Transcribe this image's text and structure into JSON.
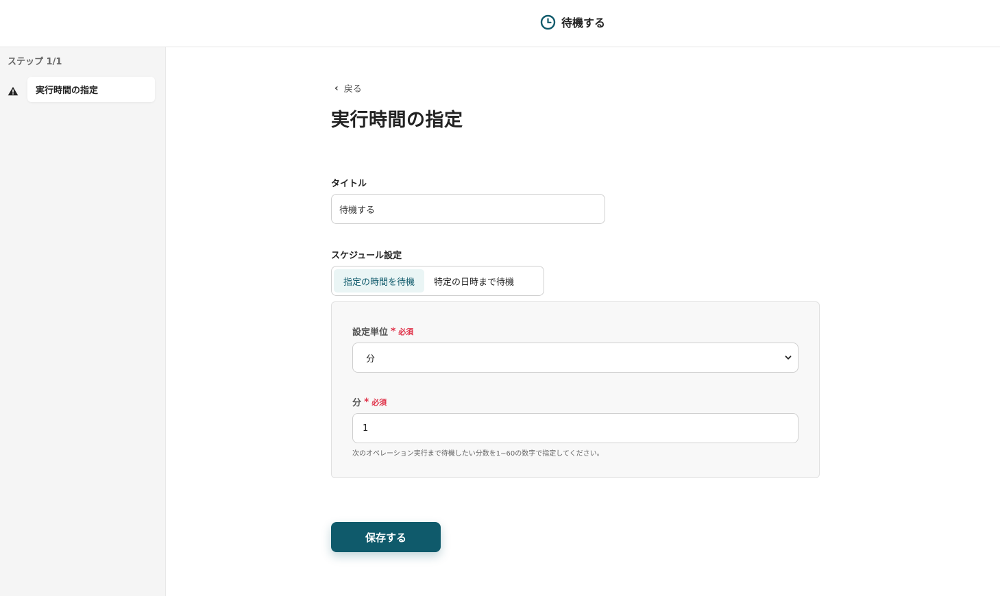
{
  "header": {
    "title": "待機する",
    "icon": "clock-icon",
    "accent_color": "#0f5a6b"
  },
  "sidebar": {
    "step_count": "ステップ 1/1",
    "items": [
      {
        "label": "実行時間の指定",
        "status_icon": "warning-icon"
      }
    ]
  },
  "main": {
    "back_label": "戻る",
    "page_title": "実行時間の指定",
    "title_field": {
      "label": "タイトル",
      "value": "待機する"
    },
    "schedule": {
      "label": "スケジュール設定",
      "options": [
        "指定の時間を待機",
        "特定の日時まで待機"
      ],
      "selected": "指定の時間を待機"
    },
    "unit_field": {
      "label": "設定単位",
      "required_label": "必須",
      "value": "分"
    },
    "minutes_field": {
      "label": "分",
      "required_label": "必須",
      "value": "1",
      "hint": "次のオペレーション実行まで待機したい分数を1~60の数字で指定してください。"
    },
    "save_label": "保存する"
  }
}
